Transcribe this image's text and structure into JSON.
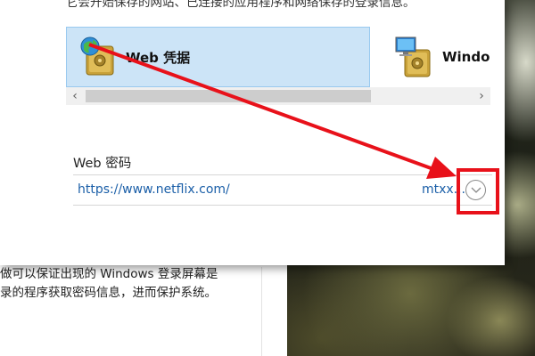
{
  "dialog": {
    "top_text": "它会开始保存的网站、已连接的应用程序和网络保存的登录信息。",
    "credential_tiles": [
      {
        "label": "Web 凭据",
        "icon": "globe-safe-icon",
        "selected": true
      },
      {
        "label": "Windows",
        "icon": "computer-safe-icon",
        "selected": false
      }
    ],
    "scroll_left": "‹",
    "scroll_right": "›",
    "section_title": "Web 密码",
    "password_entries": [
      {
        "url": "https://www.netflix.com/",
        "user": "mtxx..."
      }
    ]
  },
  "back_window": {
    "lines": [
      "做可以保证出现的 Windows 登录屏幕是",
      "录的程序获取密码信息，进而保护系统。"
    ]
  },
  "annotation": {
    "arrow_color": "#e8111a",
    "box_color": "#e8111a"
  },
  "colors": {
    "selected_tile_bg": "#cce4f7",
    "link": "#1b5fa8"
  }
}
